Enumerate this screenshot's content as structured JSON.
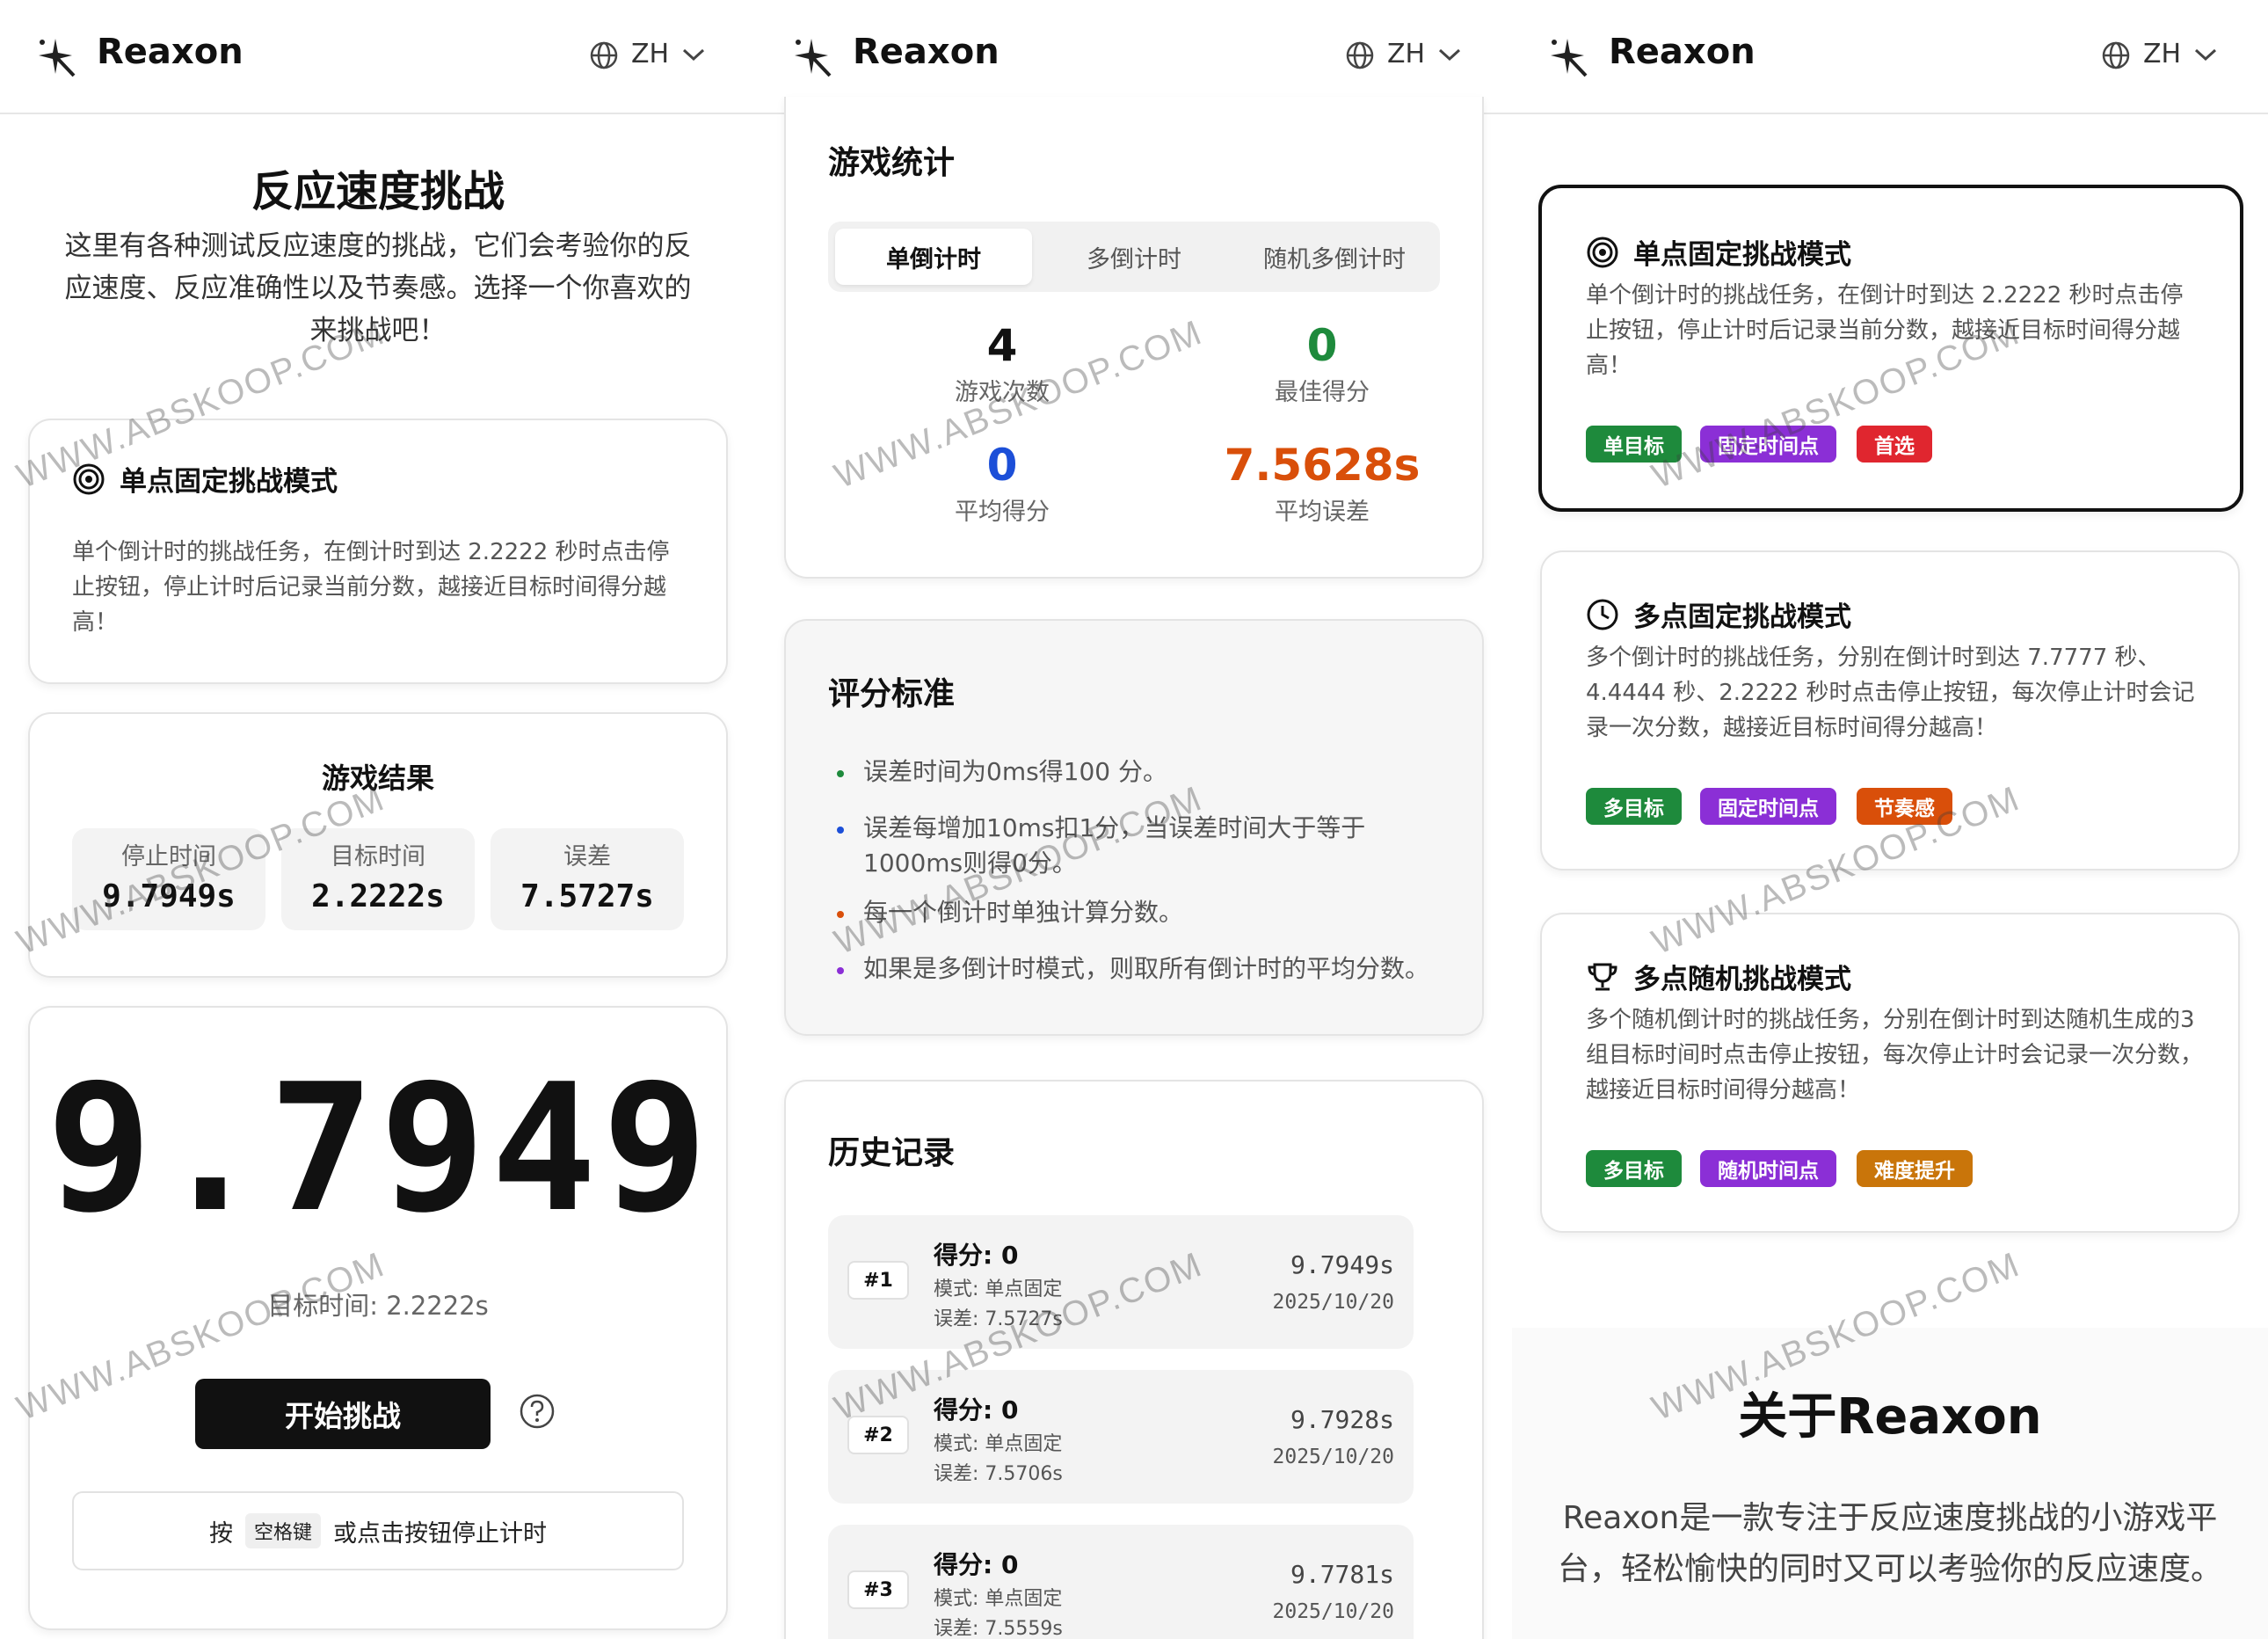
{
  "app": {
    "brand": "Reaxon",
    "lang": "ZH"
  },
  "colors": {
    "green": "#1e8a3c",
    "purple": "#8b2fd6",
    "red": "#e0262f",
    "orange": "#d94f0a",
    "amber": "#c9750a",
    "blue": "#1c4fd8"
  },
  "watermark": "WWW.ABSKOOP.COM",
  "page1": {
    "title": "反应速度挑战",
    "description": "这里有各种测试反应速度的挑战，它们会考验你的反应速度、反应准确性以及节奏感。选择一个你喜欢的来挑战吧！",
    "mode_title": "单点固定挑战模式",
    "mode_desc": "单个倒计时的挑战任务，在倒计时到达 2.2222 秒时点击停止按钮，停止计时后记录当前分数，越接近目标时间得分越高！",
    "result_title": "游戏结果",
    "results": [
      {
        "label": "停止时间",
        "value": "9.7949s"
      },
      {
        "label": "目标时间",
        "value": "2.2222s"
      },
      {
        "label": "误差",
        "value": "7.5727s"
      }
    ],
    "timer": "9.7949",
    "target_line": "目标时间: 2.2222s",
    "start_button": "开始挑战",
    "hint_prefix": "按",
    "hint_key": "空格键",
    "hint_suffix": "或点击按钮停止计时"
  },
  "page2": {
    "stats_title": "游戏统计",
    "tabs": [
      "单倒计时",
      "多倒计时",
      "随机多倒计时"
    ],
    "stats": [
      {
        "value": "4",
        "label": "游戏次数"
      },
      {
        "value": "0",
        "label": "最佳得分"
      },
      {
        "value": "0",
        "label": "平均得分"
      },
      {
        "value": "7.5628s",
        "label": "平均误差"
      }
    ],
    "rules_title": "评分标准",
    "rules": [
      "误差时间为0ms得100 分。",
      "误差每增加10ms扣1分，当误差时间大于等于1000ms则得0分。",
      "每一个倒计时单独计算分数。",
      "如果是多倒计时模式，则取所有倒计时的平均分数。"
    ],
    "history_title": "历史记录",
    "history": [
      {
        "rank": "#1",
        "score": "得分: 0",
        "mode": "模式: 单点固定",
        "err": "误差: 7.5727s",
        "time": "9.7949s",
        "date": "2025/10/20"
      },
      {
        "rank": "#2",
        "score": "得分: 0",
        "mode": "模式: 单点固定",
        "err": "误差: 7.5706s",
        "time": "9.7928s",
        "date": "2025/10/20"
      },
      {
        "rank": "#3",
        "score": "得分: 0",
        "mode": "模式: 单点固定",
        "err": "误差: 7.5559s",
        "time": "9.7781s",
        "date": "2025/10/20"
      }
    ]
  },
  "page3": {
    "modes": [
      {
        "title": "单点固定挑战模式",
        "desc": "单个倒计时的挑战任务，在倒计时到达 2.2222 秒时点击停止按钮，停止计时后记录当前分数，越接近目标时间得分越高！",
        "tags": [
          "单目标",
          "固定时间点",
          "首选"
        ]
      },
      {
        "title": "多点固定挑战模式",
        "desc": "多个倒计时的挑战任务，分别在倒计时到达 7.7777 秒、4.4444 秒、2.2222 秒时点击停止按钮，每次停止计时会记录一次分数，越接近目标时间得分越高！",
        "tags": [
          "多目标",
          "固定时间点",
          "节奏感"
        ]
      },
      {
        "title": "多点随机挑战模式",
        "desc": "多个随机倒计时的挑战任务，分别在倒计时到达随机生成的3组目标时间时点击停止按钮，每次停止计时会记录一次分数，越接近目标时间得分越高！",
        "tags": [
          "多目标",
          "随机时间点",
          "难度提升"
        ]
      }
    ],
    "about_title": "关于Reaxon",
    "about_desc": "Reaxon是一款专注于反应速度挑战的小游戏平台，轻松愉快的同时又可以考验你的反应速度。"
  }
}
